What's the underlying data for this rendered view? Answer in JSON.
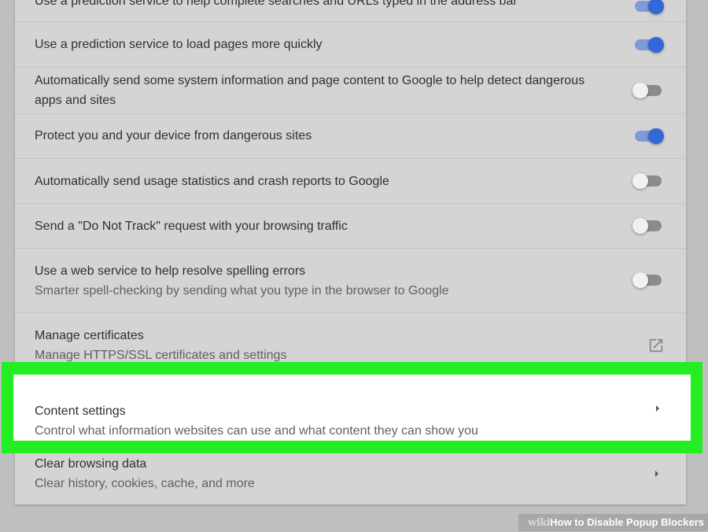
{
  "settings": {
    "rows": [
      {
        "title": "Use a prediction service to help complete searches and URLs typed in the address bar",
        "toggle_on": true
      },
      {
        "title": "Use a prediction service to load pages more quickly",
        "toggle_on": true
      },
      {
        "title": "Automatically send some system information and page content to Google to help detect dangerous apps and sites",
        "toggle_on": false
      },
      {
        "title": "Protect you and your device from dangerous sites",
        "toggle_on": true
      },
      {
        "title": "Automatically send usage statistics and crash reports to Google",
        "toggle_on": false
      },
      {
        "title": "Send a \"Do Not Track\" request with your browsing traffic",
        "toggle_on": false
      },
      {
        "title": "Use a web service to help resolve spelling errors",
        "subtitle": "Smarter spell-checking by sending what you type in the browser to Google",
        "toggle_on": false
      },
      {
        "title": "Manage certificates",
        "subtitle": "Manage HTTPS/SSL certificates and settings",
        "icon": "open-in-new-icon"
      },
      {
        "title": "Content settings",
        "subtitle": "Control what information websites can use and what content they can show you",
        "icon": "chevron-right-icon",
        "highlighted": true
      },
      {
        "title": "Clear browsing data",
        "subtitle": "Clear history, cookies, cache, and more",
        "icon": "chevron-right-icon"
      }
    ]
  },
  "watermark": {
    "brand": "wiki",
    "title": "How to Disable Popup Blockers"
  },
  "colors": {
    "toggle_on_knob": "#3368d8",
    "toggle_on_track": "#7f99d9",
    "toggle_off_track": "#8b8b8b",
    "highlight": "#22ee22"
  }
}
